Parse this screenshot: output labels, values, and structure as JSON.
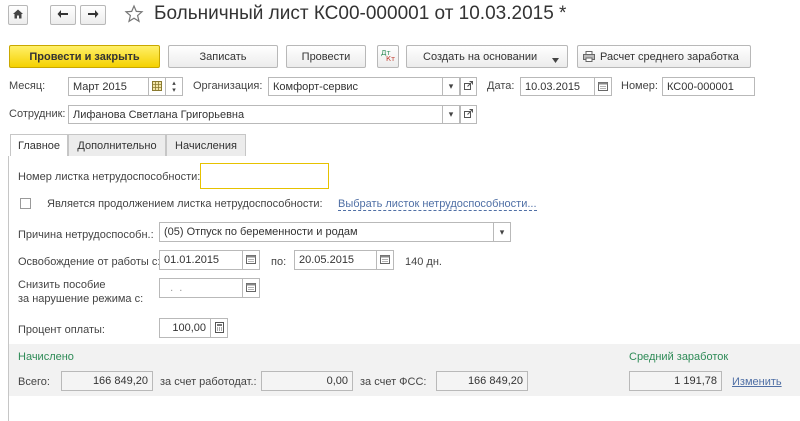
{
  "window": {
    "title": "Больничный лист КС00-000001 от 10.03.2015 *"
  },
  "icons": {
    "home": "home-icon",
    "back": "arrow-left-icon",
    "forward": "arrow-right-icon",
    "favorite": "star-icon"
  },
  "toolbar": {
    "post_close_label": "Провести и закрыть",
    "save_label": "Записать",
    "post_label": "Провести",
    "create_based_label": "Создать на основании",
    "calc_avg_label": "Расчет среднего заработка"
  },
  "header": {
    "month_label": "Месяц:",
    "month_value": "Март 2015",
    "org_label": "Организация:",
    "org_value": "Комфорт-сервис",
    "date_label": "Дата:",
    "date_value": "10.03.2015",
    "number_label": "Номер:",
    "number_value": "КС00-000001",
    "employee_label": "Сотрудник:",
    "employee_value": "Лифанова Светлана Григорьевна"
  },
  "tabs": [
    {
      "label": "Главное"
    },
    {
      "label": "Дополнительно"
    },
    {
      "label": "Начисления"
    }
  ],
  "main": {
    "sheet_number_label": "Номер листка нетрудоспособности:",
    "sheet_number_value": "",
    "continuation_label": "Является продолжением листка нетрудоспособности:",
    "continuation_checked": false,
    "choose_sheet_link": "Выбрать листок нетрудоспособности...",
    "reason_label": "Причина нетрудоспособн.:",
    "reason_value": "(05) Отпуск по беременности и родам",
    "release_label": "Освобождение от работы с:",
    "release_from": "01.01.2015",
    "release_to_label": "по:",
    "release_to": "20.05.2015",
    "days_text": "140 дн.",
    "reduce_label_line1": "Снизить пособие",
    "reduce_label_line2": "за нарушение режима с:",
    "reduce_value": "  .  .",
    "percent_label": "Процент оплаты:",
    "percent_value": "100,00"
  },
  "totals": {
    "accrued_header": "Начислено",
    "avg_earnings_header": "Средний заработок",
    "total_label": "Всего:",
    "total_value": "166 849,20",
    "employer_label": "за счет работодат.:",
    "employer_value": "0,00",
    "fss_label": "за счет ФСС:",
    "fss_value": "166 849,20",
    "avg_value": "1 191,78",
    "change_link": "Изменить"
  },
  "colors": {
    "primary_button": "#f5d100",
    "accent_green": "#2e8b57",
    "link": "#4f6fa5",
    "highlight_border": "#e6c200"
  }
}
